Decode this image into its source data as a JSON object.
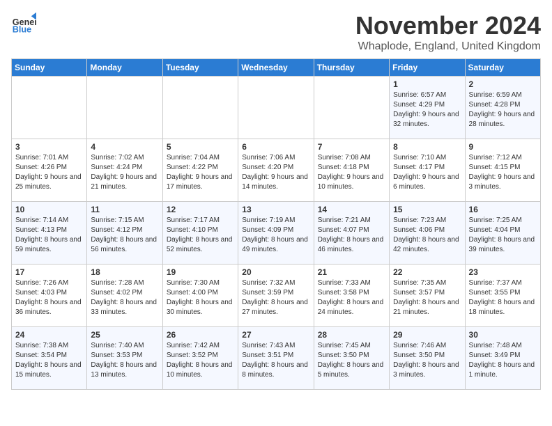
{
  "logo": {
    "general": "General",
    "blue": "Blue"
  },
  "title": "November 2024",
  "location": "Whaplode, England, United Kingdom",
  "days_of_week": [
    "Sunday",
    "Monday",
    "Tuesday",
    "Wednesday",
    "Thursday",
    "Friday",
    "Saturday"
  ],
  "weeks": [
    [
      {
        "day": "",
        "info": ""
      },
      {
        "day": "",
        "info": ""
      },
      {
        "day": "",
        "info": ""
      },
      {
        "day": "",
        "info": ""
      },
      {
        "day": "",
        "info": ""
      },
      {
        "day": "1",
        "info": "Sunrise: 6:57 AM\nSunset: 4:29 PM\nDaylight: 9 hours and 32 minutes."
      },
      {
        "day": "2",
        "info": "Sunrise: 6:59 AM\nSunset: 4:28 PM\nDaylight: 9 hours and 28 minutes."
      }
    ],
    [
      {
        "day": "3",
        "info": "Sunrise: 7:01 AM\nSunset: 4:26 PM\nDaylight: 9 hours and 25 minutes."
      },
      {
        "day": "4",
        "info": "Sunrise: 7:02 AM\nSunset: 4:24 PM\nDaylight: 9 hours and 21 minutes."
      },
      {
        "day": "5",
        "info": "Sunrise: 7:04 AM\nSunset: 4:22 PM\nDaylight: 9 hours and 17 minutes."
      },
      {
        "day": "6",
        "info": "Sunrise: 7:06 AM\nSunset: 4:20 PM\nDaylight: 9 hours and 14 minutes."
      },
      {
        "day": "7",
        "info": "Sunrise: 7:08 AM\nSunset: 4:18 PM\nDaylight: 9 hours and 10 minutes."
      },
      {
        "day": "8",
        "info": "Sunrise: 7:10 AM\nSunset: 4:17 PM\nDaylight: 9 hours and 6 minutes."
      },
      {
        "day": "9",
        "info": "Sunrise: 7:12 AM\nSunset: 4:15 PM\nDaylight: 9 hours and 3 minutes."
      }
    ],
    [
      {
        "day": "10",
        "info": "Sunrise: 7:14 AM\nSunset: 4:13 PM\nDaylight: 8 hours and 59 minutes."
      },
      {
        "day": "11",
        "info": "Sunrise: 7:15 AM\nSunset: 4:12 PM\nDaylight: 8 hours and 56 minutes."
      },
      {
        "day": "12",
        "info": "Sunrise: 7:17 AM\nSunset: 4:10 PM\nDaylight: 8 hours and 52 minutes."
      },
      {
        "day": "13",
        "info": "Sunrise: 7:19 AM\nSunset: 4:09 PM\nDaylight: 8 hours and 49 minutes."
      },
      {
        "day": "14",
        "info": "Sunrise: 7:21 AM\nSunset: 4:07 PM\nDaylight: 8 hours and 46 minutes."
      },
      {
        "day": "15",
        "info": "Sunrise: 7:23 AM\nSunset: 4:06 PM\nDaylight: 8 hours and 42 minutes."
      },
      {
        "day": "16",
        "info": "Sunrise: 7:25 AM\nSunset: 4:04 PM\nDaylight: 8 hours and 39 minutes."
      }
    ],
    [
      {
        "day": "17",
        "info": "Sunrise: 7:26 AM\nSunset: 4:03 PM\nDaylight: 8 hours and 36 minutes."
      },
      {
        "day": "18",
        "info": "Sunrise: 7:28 AM\nSunset: 4:02 PM\nDaylight: 8 hours and 33 minutes."
      },
      {
        "day": "19",
        "info": "Sunrise: 7:30 AM\nSunset: 4:00 PM\nDaylight: 8 hours and 30 minutes."
      },
      {
        "day": "20",
        "info": "Sunrise: 7:32 AM\nSunset: 3:59 PM\nDaylight: 8 hours and 27 minutes."
      },
      {
        "day": "21",
        "info": "Sunrise: 7:33 AM\nSunset: 3:58 PM\nDaylight: 8 hours and 24 minutes."
      },
      {
        "day": "22",
        "info": "Sunrise: 7:35 AM\nSunset: 3:57 PM\nDaylight: 8 hours and 21 minutes."
      },
      {
        "day": "23",
        "info": "Sunrise: 7:37 AM\nSunset: 3:55 PM\nDaylight: 8 hours and 18 minutes."
      }
    ],
    [
      {
        "day": "24",
        "info": "Sunrise: 7:38 AM\nSunset: 3:54 PM\nDaylight: 8 hours and 15 minutes."
      },
      {
        "day": "25",
        "info": "Sunrise: 7:40 AM\nSunset: 3:53 PM\nDaylight: 8 hours and 13 minutes."
      },
      {
        "day": "26",
        "info": "Sunrise: 7:42 AM\nSunset: 3:52 PM\nDaylight: 8 hours and 10 minutes."
      },
      {
        "day": "27",
        "info": "Sunrise: 7:43 AM\nSunset: 3:51 PM\nDaylight: 8 hours and 8 minutes."
      },
      {
        "day": "28",
        "info": "Sunrise: 7:45 AM\nSunset: 3:50 PM\nDaylight: 8 hours and 5 minutes."
      },
      {
        "day": "29",
        "info": "Sunrise: 7:46 AM\nSunset: 3:50 PM\nDaylight: 8 hours and 3 minutes."
      },
      {
        "day": "30",
        "info": "Sunrise: 7:48 AM\nSunset: 3:49 PM\nDaylight: 8 hours and 1 minute."
      }
    ]
  ]
}
